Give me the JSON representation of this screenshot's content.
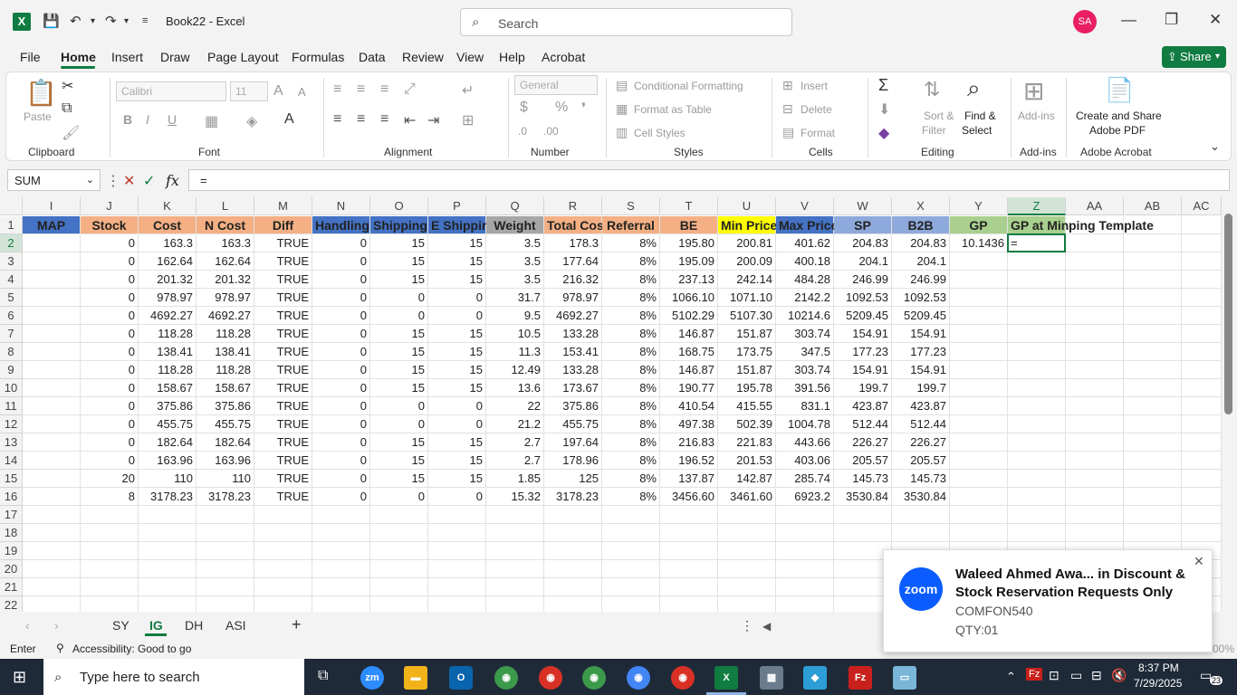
{
  "titlebar": {
    "logo": "X",
    "title": "Book22  -  Excel",
    "search_placeholder": "Search",
    "avatar": "SA",
    "minimize": "—",
    "restore": "❐",
    "close": "✕"
  },
  "menu": [
    "File",
    "Home",
    "Insert",
    "Draw",
    "Page Layout",
    "Formulas",
    "Data",
    "Review",
    "View",
    "Help",
    "Acrobat"
  ],
  "share_label": "Share",
  "ribbon": {
    "groups": [
      "Clipboard",
      "Font",
      "Alignment",
      "Number",
      "Styles",
      "Cells",
      "Editing",
      "Add-ins",
      "Adobe Acrobat"
    ],
    "paste": "Paste",
    "font_name": "Calibri",
    "font_size": "11",
    "number_format": "General",
    "conditional": "Conditional Formatting",
    "format_table": "Format as Table",
    "cell_styles": "Cell Styles",
    "insert": "Insert",
    "delete": "Delete",
    "format": "Format",
    "sort_filter1": "Sort &",
    "sort_filter2": "Filter",
    "find_select1": "Find &",
    "find_select2": "Select",
    "addins": "Add-ins",
    "create_share1": "Create and Share",
    "create_share2": "Adobe PDF"
  },
  "formula_bar": {
    "name_box": "SUM",
    "formula": "="
  },
  "grid": {
    "columns": [
      "I",
      "J",
      "K",
      "L",
      "M",
      "N",
      "O",
      "P",
      "Q",
      "R",
      "S",
      "T",
      "U",
      "V",
      "W",
      "X",
      "Y",
      "Z",
      "AA",
      "AB",
      "AC"
    ],
    "selected_column": "Z",
    "selected_row": "2",
    "row_numbers": [
      "1",
      "2",
      "3",
      "4",
      "5",
      "6",
      "7",
      "8",
      "9",
      "10",
      "11",
      "12",
      "13",
      "14",
      "15",
      "16",
      "17",
      "18",
      "19",
      "20",
      "21",
      "22"
    ],
    "headers": [
      "MAP",
      "Stock",
      "Cost",
      "N Cost",
      "Diff",
      "Handling",
      "Shipping",
      "E Shipping",
      "Weight",
      "Total Cost",
      "Referral",
      "BE",
      "Min Price",
      "Max Price",
      "SP",
      "B2B",
      "GP",
      "GP at Min",
      "ping Template"
    ],
    "header_colors": [
      "#4472c4",
      "#f4b084",
      "#f4b084",
      "#f4b084",
      "#f4b084",
      "#4472c4",
      "#4472c4",
      "#4472c4",
      "#a6a6a6",
      "#f4b084",
      "#f4b084",
      "#f4b084",
      "#ffff00",
      "#4472c4",
      "#8ea9db",
      "#8ea9db",
      "#a9d08e",
      "#a9d08e",
      ""
    ],
    "rows": [
      [
        "",
        "0",
        "163.3",
        "163.3",
        "TRUE",
        "0",
        "15",
        "15",
        "3.5",
        "178.3",
        "8%",
        "195.80",
        "200.81",
        "401.62",
        "204.83",
        "204.83",
        "10.1436",
        "="
      ],
      [
        "",
        "0",
        "162.64",
        "162.64",
        "TRUE",
        "0",
        "15",
        "15",
        "3.5",
        "177.64",
        "8%",
        "195.09",
        "200.09",
        "400.18",
        "204.1",
        "204.1",
        "",
        ""
      ],
      [
        "",
        "0",
        "201.32",
        "201.32",
        "TRUE",
        "0",
        "15",
        "15",
        "3.5",
        "216.32",
        "8%",
        "237.13",
        "242.14",
        "484.28",
        "246.99",
        "246.99",
        "",
        ""
      ],
      [
        "",
        "0",
        "978.97",
        "978.97",
        "TRUE",
        "0",
        "0",
        "0",
        "31.7",
        "978.97",
        "8%",
        "1066.10",
        "1071.10",
        "2142.2",
        "1092.53",
        "1092.53",
        "",
        ""
      ],
      [
        "",
        "0",
        "4692.27",
        "4692.27",
        "TRUE",
        "0",
        "0",
        "0",
        "9.5",
        "4692.27",
        "8%",
        "5102.29",
        "5107.30",
        "10214.6",
        "5209.45",
        "5209.45",
        "",
        ""
      ],
      [
        "",
        "0",
        "118.28",
        "118.28",
        "TRUE",
        "0",
        "15",
        "15",
        "10.5",
        "133.28",
        "8%",
        "146.87",
        "151.87",
        "303.74",
        "154.91",
        "154.91",
        "",
        ""
      ],
      [
        "",
        "0",
        "138.41",
        "138.41",
        "TRUE",
        "0",
        "15",
        "15",
        "11.3",
        "153.41",
        "8%",
        "168.75",
        "173.75",
        "347.5",
        "177.23",
        "177.23",
        "",
        ""
      ],
      [
        "",
        "0",
        "118.28",
        "118.28",
        "TRUE",
        "0",
        "15",
        "15",
        "12.49",
        "133.28",
        "8%",
        "146.87",
        "151.87",
        "303.74",
        "154.91",
        "154.91",
        "",
        ""
      ],
      [
        "",
        "0",
        "158.67",
        "158.67",
        "TRUE",
        "0",
        "15",
        "15",
        "13.6",
        "173.67",
        "8%",
        "190.77",
        "195.78",
        "391.56",
        "199.7",
        "199.7",
        "",
        ""
      ],
      [
        "",
        "0",
        "375.86",
        "375.86",
        "TRUE",
        "0",
        "0",
        "0",
        "22",
        "375.86",
        "8%",
        "410.54",
        "415.55",
        "831.1",
        "423.87",
        "423.87",
        "",
        ""
      ],
      [
        "",
        "0",
        "455.75",
        "455.75",
        "TRUE",
        "0",
        "0",
        "0",
        "21.2",
        "455.75",
        "8%",
        "497.38",
        "502.39",
        "1004.78",
        "512.44",
        "512.44",
        "",
        ""
      ],
      [
        "",
        "0",
        "182.64",
        "182.64",
        "TRUE",
        "0",
        "15",
        "15",
        "2.7",
        "197.64",
        "8%",
        "216.83",
        "221.83",
        "443.66",
        "226.27",
        "226.27",
        "",
        ""
      ],
      [
        "",
        "0",
        "163.96",
        "163.96",
        "TRUE",
        "0",
        "15",
        "15",
        "2.7",
        "178.96",
        "8%",
        "196.52",
        "201.53",
        "403.06",
        "205.57",
        "205.57",
        "",
        ""
      ],
      [
        "",
        "20",
        "110",
        "110",
        "TRUE",
        "0",
        "15",
        "15",
        "1.85",
        "125",
        "8%",
        "137.87",
        "142.87",
        "285.74",
        "145.73",
        "145.73",
        "",
        ""
      ],
      [
        "",
        "8",
        "3178.23",
        "3178.23",
        "TRUE",
        "0",
        "0",
        "0",
        "15.32",
        "3178.23",
        "8%",
        "3456.60",
        "3461.60",
        "6923.2",
        "3530.84",
        "3530.84",
        "",
        ""
      ]
    ]
  },
  "sheet_tabs": [
    "SY",
    "IG",
    "DH",
    "ASI"
  ],
  "active_tab": "IG",
  "add_sheet": "+",
  "status": {
    "mode": "Enter",
    "accessibility": "Accessibility: Good to go",
    "zoom": "00%"
  },
  "taskbar": {
    "search_placeholder": "Type here to search",
    "time": "8:37 PM",
    "date": "7/29/2025",
    "notifications": "23"
  },
  "toast": {
    "app": "zoom",
    "title": "Waleed Ahmed Awa... in Discount & Stock Reservation Requests Only",
    "line1": "COMFON540",
    "line2": "QTY:01",
    "close": "✕"
  }
}
